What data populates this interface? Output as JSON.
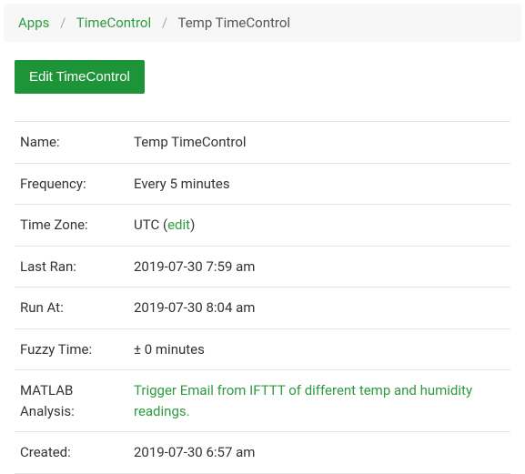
{
  "breadcrumb": {
    "items": [
      {
        "label": "Apps"
      },
      {
        "label": "TimeControl"
      }
    ],
    "current": "Temp TimeControl",
    "separator": "/"
  },
  "actions": {
    "edit_label": "Edit TimeControl"
  },
  "details": {
    "name": {
      "label": "Name:",
      "value": "Temp TimeControl"
    },
    "frequency": {
      "label": "Frequency:",
      "value": "Every 5 minutes"
    },
    "timezone": {
      "label": "Time Zone:",
      "value_prefix": "UTC (",
      "edit_link": "edit",
      "value_suffix": ")"
    },
    "last_ran": {
      "label": "Last Ran:",
      "value": "2019-07-30 7:59 am"
    },
    "run_at": {
      "label": "Run At:",
      "value": "2019-07-30 8:04 am"
    },
    "fuzzy_time": {
      "label": "Fuzzy Time:",
      "value": "± 0 minutes"
    },
    "matlab": {
      "label": "MATLAB Analysis:",
      "value": "Trigger Email from IFTTT of different temp and humidity readings."
    },
    "created": {
      "label": "Created:",
      "value": "2019-07-30 6:57 am"
    }
  }
}
